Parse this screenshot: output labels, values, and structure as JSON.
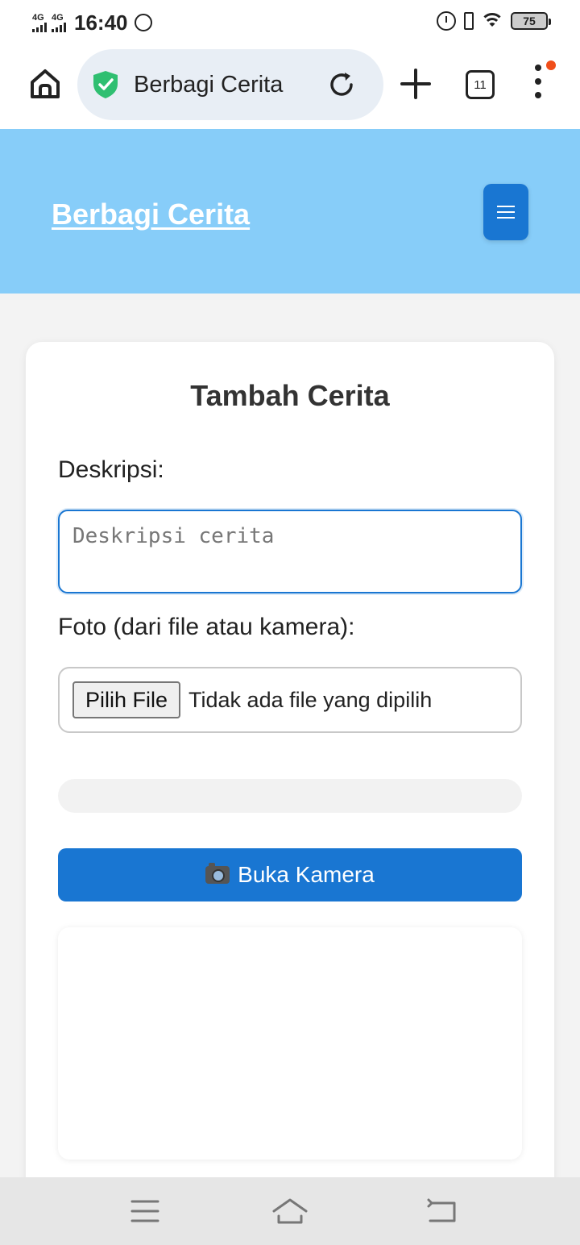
{
  "status_bar": {
    "network_1": "4G",
    "network_2": "4G",
    "time": "16:40",
    "battery": "75"
  },
  "browser": {
    "page_title": "Berbagi Cerita",
    "tab_count": "11"
  },
  "site_header": {
    "brand": "Berbagi Cerita"
  },
  "form": {
    "title": "Tambah Cerita",
    "description_label": "Deskripsi:",
    "description_placeholder": "Deskripsi cerita",
    "description_value": "",
    "photo_label": "Foto (dari file atau kamera):",
    "choose_file_label": "Pilih File",
    "file_status": "Tidak ada file yang dipilih",
    "camera_button": "Buka Kamera"
  },
  "colors": {
    "header_bg": "#87cdf9",
    "primary": "#1976d2",
    "secure_green": "#2fbf71",
    "notification": "#f04e1a"
  },
  "icons": [
    "home-icon",
    "shield-check-icon",
    "reload-icon",
    "plus-icon",
    "tabs-icon",
    "more-vert-icon",
    "hamburger-icon",
    "camera-icon",
    "nav-menu-icon",
    "nav-home-icon",
    "nav-back-icon"
  ]
}
